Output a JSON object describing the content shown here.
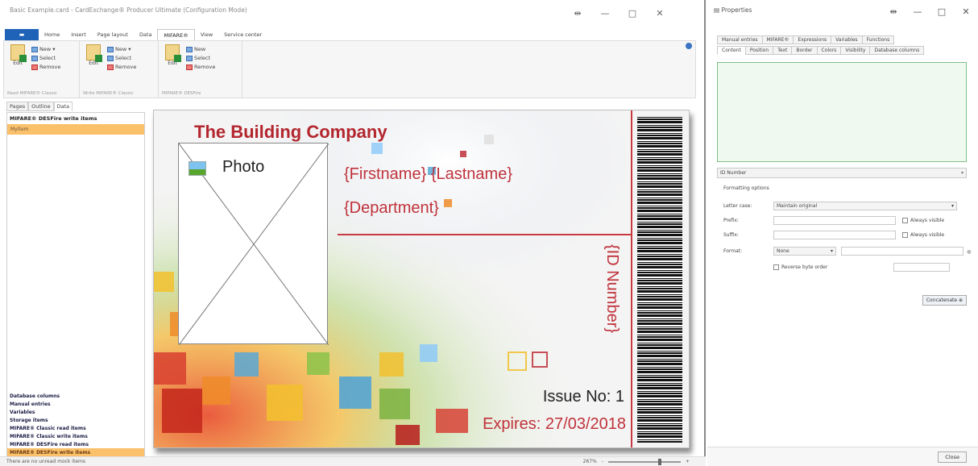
{
  "app": {
    "title": "Basic Example.card - CardExchange® Producer Ultimate (Configuration Mode)",
    "window_controls": {
      "pin": "⇹",
      "minimize": "—",
      "maximize": "□",
      "close": "✕"
    }
  },
  "ribbon": {
    "file_label": "",
    "tabs": [
      "Home",
      "Insert",
      "Page layout",
      "Data",
      "MIFARE®",
      "View",
      "Service center"
    ],
    "active_tab": "MIFARE®",
    "groups": [
      {
        "name": "Read MIFARE® Classic",
        "edit": "Edit",
        "new": "New",
        "select": "Select",
        "remove": "Remove"
      },
      {
        "name": "Write MIFARE® Classic",
        "edit": "Edit",
        "new": "New",
        "select": "Select",
        "remove": "Remove"
      },
      {
        "name": "MIFARE® DESFire",
        "edit": "Edit",
        "new": "New",
        "select": "Select",
        "remove": "Remove"
      }
    ]
  },
  "sidebar": {
    "tabs": [
      "Pages",
      "Outline",
      "Data"
    ],
    "active_tab": "Data",
    "heading": "MIFARE® DESFire write items",
    "selected_item": "MyItem",
    "bottom_items": [
      "Database columns",
      "Manual entries",
      "Variables",
      "Storage items",
      "MIFARE® Classic read items",
      "MIFARE® Classic write items",
      "MIFARE® DESFire read items",
      "MIFARE® DESFire write items"
    ],
    "bottom_selected": "MIFARE® DESFire write items"
  },
  "card": {
    "company": "The Building Company",
    "photo_label": "Photo",
    "name_field": "{Firstname} {Lastname}",
    "department_field": "{Department}",
    "id_field": "{ID Number}",
    "issue": "Issue No: 1",
    "expires": "Expires: 27/03/2018"
  },
  "status": {
    "text": "There are no unread mock items",
    "zoom": "267%",
    "zoom_minus": "-",
    "zoom_plus": "+"
  },
  "properties": {
    "title": "Properties",
    "tabs_row1": [
      "Manual entries",
      "MIFARE®",
      "Expressions",
      "Variables",
      "Functions"
    ],
    "tabs_row2": [
      "Content",
      "Position",
      "Text",
      "Border",
      "Colors",
      "Visibility",
      "Database columns"
    ],
    "active_tab_row2": "Content",
    "selected_field": "ID Number",
    "formatting": {
      "title": "Formatting options",
      "letter_case_label": "Letter case:",
      "letter_case_value": "Maintain original",
      "prefix_label": "Prefix:",
      "suffix_label": "Suffix:",
      "always_visible": "Always visible",
      "format_label": "Format:",
      "format_value": "None",
      "reverse_byte_order": "Reverse byte order"
    },
    "concatenate": "Concatenate",
    "close": "Close"
  },
  "colors": {
    "accent": "#c0323b",
    "ribbon_blue": "#1f63b8",
    "selection": "#fbc06a"
  }
}
